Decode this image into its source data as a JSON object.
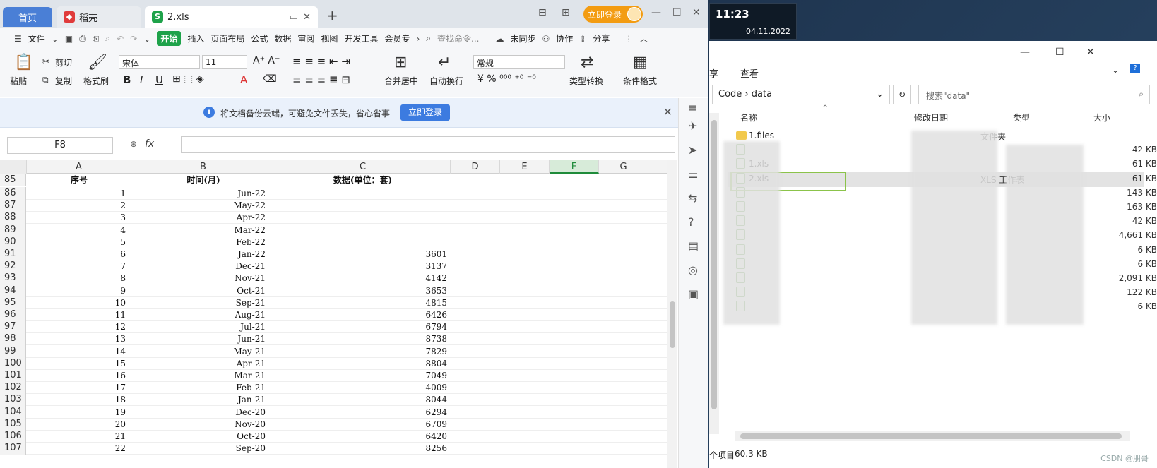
{
  "desktop": {
    "clock_time": "11:23",
    "clock_date": "04.11.2022",
    "watermark": "CSDN @朋哥"
  },
  "wps": {
    "tabs": {
      "home": "首页",
      "docer": "稻壳",
      "current": "2.xls"
    },
    "login_button": "立即登录",
    "menu": {
      "file": "文件",
      "start": "开始",
      "insert": "插入",
      "layout": "页面布局",
      "formula": "公式",
      "data": "数据",
      "review": "审阅",
      "view": "视图",
      "dev": "开发工具",
      "member": "会员专",
      "search": "查找命令...",
      "sync": "未同步",
      "collab": "协作",
      "share": "分享"
    },
    "ribbon": {
      "paste": "粘贴",
      "cut": "剪切",
      "copy": "复制",
      "format_painter": "格式刷",
      "font": "宋体",
      "size": "11",
      "merge": "合并居中",
      "wrap": "自动换行",
      "number_format": "常规",
      "type_convert": "类型转换",
      "cond_format": "条件格式"
    },
    "notice": {
      "text": "将文档备份云端，可避免文件丢失，省心省事",
      "button": "立即登录"
    },
    "name_box": "F8",
    "fx": "fx",
    "columns": [
      "A",
      "B",
      "C",
      "D",
      "E",
      "F",
      "G"
    ],
    "header_row": {
      "row": "85",
      "a": "序号",
      "b": "时间(月)",
      "c": "数据(单位：套)"
    },
    "rows": [
      {
        "row": "86",
        "a": "1",
        "b": "Jun-22",
        "c": ""
      },
      {
        "row": "87",
        "a": "2",
        "b": "May-22",
        "c": ""
      },
      {
        "row": "88",
        "a": "3",
        "b": "Apr-22",
        "c": ""
      },
      {
        "row": "89",
        "a": "4",
        "b": "Mar-22",
        "c": ""
      },
      {
        "row": "90",
        "a": "5",
        "b": "Feb-22",
        "c": ""
      },
      {
        "row": "91",
        "a": "6",
        "b": "Jan-22",
        "c": "3601"
      },
      {
        "row": "92",
        "a": "7",
        "b": "Dec-21",
        "c": "3137"
      },
      {
        "row": "93",
        "a": "8",
        "b": "Nov-21",
        "c": "4142"
      },
      {
        "row": "94",
        "a": "9",
        "b": "Oct-21",
        "c": "3653"
      },
      {
        "row": "95",
        "a": "10",
        "b": "Sep-21",
        "c": "4815"
      },
      {
        "row": "96",
        "a": "11",
        "b": "Aug-21",
        "c": "6426"
      },
      {
        "row": "97",
        "a": "12",
        "b": "Jul-21",
        "c": "6794"
      },
      {
        "row": "98",
        "a": "13",
        "b": "Jun-21",
        "c": "8738"
      },
      {
        "row": "99",
        "a": "14",
        "b": "May-21",
        "c": "7829"
      },
      {
        "row": "100",
        "a": "15",
        "b": "Apr-21",
        "c": "8804"
      },
      {
        "row": "101",
        "a": "16",
        "b": "Mar-21",
        "c": "7049"
      },
      {
        "row": "102",
        "a": "17",
        "b": "Feb-21",
        "c": "4009"
      },
      {
        "row": "103",
        "a": "18",
        "b": "Jan-21",
        "c": "8044"
      },
      {
        "row": "104",
        "a": "19",
        "b": "Dec-20",
        "c": "6294"
      },
      {
        "row": "105",
        "a": "20",
        "b": "Nov-20",
        "c": "6709"
      },
      {
        "row": "106",
        "a": "21",
        "b": "Oct-20",
        "c": "6420"
      },
      {
        "row": "107",
        "a": "22",
        "b": "Sep-20",
        "c": "8256"
      }
    ]
  },
  "explorer": {
    "menu": {
      "share": "享",
      "view": "查看"
    },
    "address": {
      "part1": "Code",
      "part2": "data"
    },
    "search_placeholder": "搜索\"data\"",
    "headers": {
      "name": "名称",
      "modified": "修改日期",
      "type": "类型",
      "size": "大小"
    },
    "files": [
      {
        "name": "1.files",
        "type": "文件夹",
        "size": ""
      },
      {
        "name": "",
        "type": "",
        "size": "42 KB"
      },
      {
        "name": "1.xls",
        "type": "",
        "size": "61 KB"
      },
      {
        "name": "2.xls",
        "type": "XLS 工作表",
        "size": "61 KB"
      },
      {
        "name": "",
        "type": "",
        "size": "143 KB"
      },
      {
        "name": "",
        "type": "",
        "size": "163 KB"
      },
      {
        "name": "",
        "type": "",
        "size": "42 KB"
      },
      {
        "name": "",
        "type": "",
        "size": "4,661 KB"
      },
      {
        "name": "",
        "type": "",
        "size": "6 KB"
      },
      {
        "name": "",
        "type": "",
        "size": "6 KB"
      },
      {
        "name": "",
        "type": "",
        "size": "2,091 KB"
      },
      {
        "name": "",
        "type": "",
        "size": "122 KB"
      },
      {
        "name": "",
        "type": "",
        "size": "6 KB"
      }
    ],
    "status": {
      "items": "个项目",
      "size": "60.3 KB"
    }
  }
}
